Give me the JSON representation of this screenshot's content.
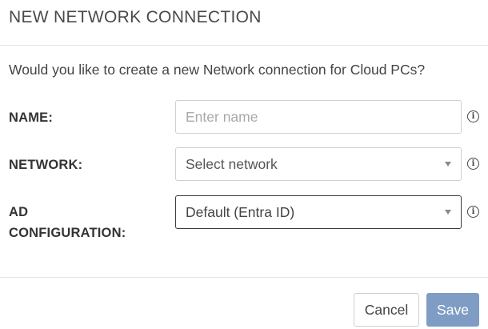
{
  "dialog": {
    "title": "NEW NETWORK CONNECTION",
    "prompt": "Would you like to create a new Network connection for Cloud PCs?"
  },
  "form": {
    "name": {
      "label": "NAME:",
      "placeholder": "Enter name",
      "value": ""
    },
    "network": {
      "label": "NETWORK:",
      "selected": "Select network"
    },
    "ad_configuration": {
      "label_line1": "AD",
      "label_line2": "CONFIGURATION:",
      "selected": "Default (Entra ID)"
    }
  },
  "icons": {
    "info": "info-icon",
    "caret": "chevron-down-icon"
  },
  "footer": {
    "cancel_label": "Cancel",
    "save_label": "Save"
  },
  "colors": {
    "save_button": "#7f9dc4",
    "divider": "#e3e3e3"
  }
}
